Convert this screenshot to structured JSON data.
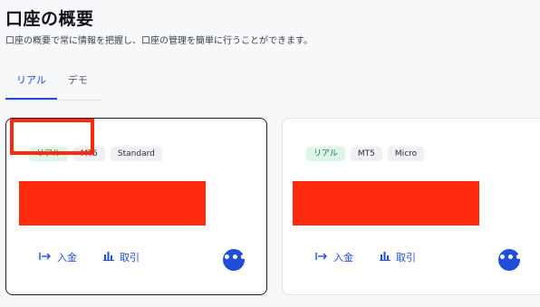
{
  "header": {
    "title": "口座の概要",
    "subtitle": "口座の概要で常に情報を把握し、口座の管理を簡単に行うことができます。"
  },
  "tabs": [
    {
      "label": "リアル",
      "active": true
    },
    {
      "label": "デモ",
      "active": false
    }
  ],
  "accounts": [
    {
      "badges": [
        "リアル",
        "MT5",
        "Standard"
      ],
      "actions": {
        "deposit": "入金",
        "trade": "取引"
      },
      "more_label": "•••"
    },
    {
      "badges": [
        "リアル",
        "MT5",
        "Micro"
      ],
      "actions": {
        "deposit": "入金",
        "trade": "取引"
      },
      "more_label": "•••"
    }
  ],
  "colors": {
    "accent": "#1f4fd6",
    "redaction": "#ff2a0d",
    "badge_real_bg": "#dff5e7",
    "badge_real_text": "#1e7a47"
  },
  "icons": {
    "deposit": "arrow-into-icon",
    "trade": "bar-chart-icon",
    "more": "more-dots-icon"
  }
}
